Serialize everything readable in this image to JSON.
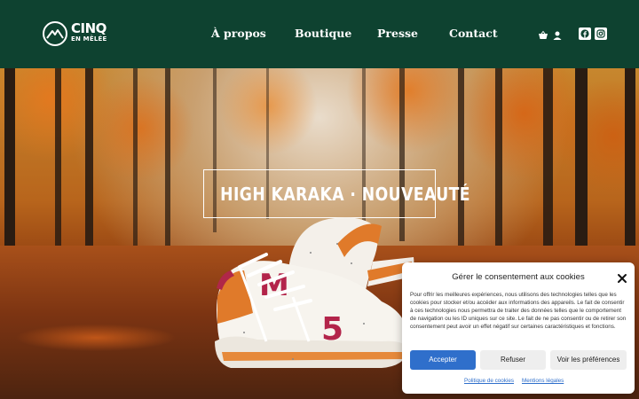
{
  "header": {
    "logo_word": "CINQ",
    "logo_sub": "EN MÊLÉE",
    "nav": [
      "À propos",
      "Boutique",
      "Presse",
      "Contact"
    ],
    "icons": [
      "cart-icon",
      "user-icon",
      "facebook-icon",
      "instagram-icon"
    ],
    "background_color": "#0e4230"
  },
  "hero": {
    "headline": "HIGH KARAKA · NOUVEAUTÉ"
  },
  "consent": {
    "title": "Gérer le consentement aux cookies",
    "body": "Pour offrir les meilleures expériences, nous utilisons des technologies telles que les cookies pour stocker et/ou accéder aux informations des appareils. Le fait de consentir à ces technologies nous permettra de traiter des données telles que le comportement de navigation ou les ID uniques sur ce site. Le fait de ne pas consentir ou de retirer son consentement peut avoir un effet négatif sur certaines caractéristiques et fonctions.",
    "accept_label": "Accepter",
    "refuse_label": "Refuser",
    "prefs_label": "Voir les préférences",
    "link_policy": "Politique de cookies",
    "link_legal": "Mentions légales",
    "accent_color": "#2f6fcb"
  }
}
